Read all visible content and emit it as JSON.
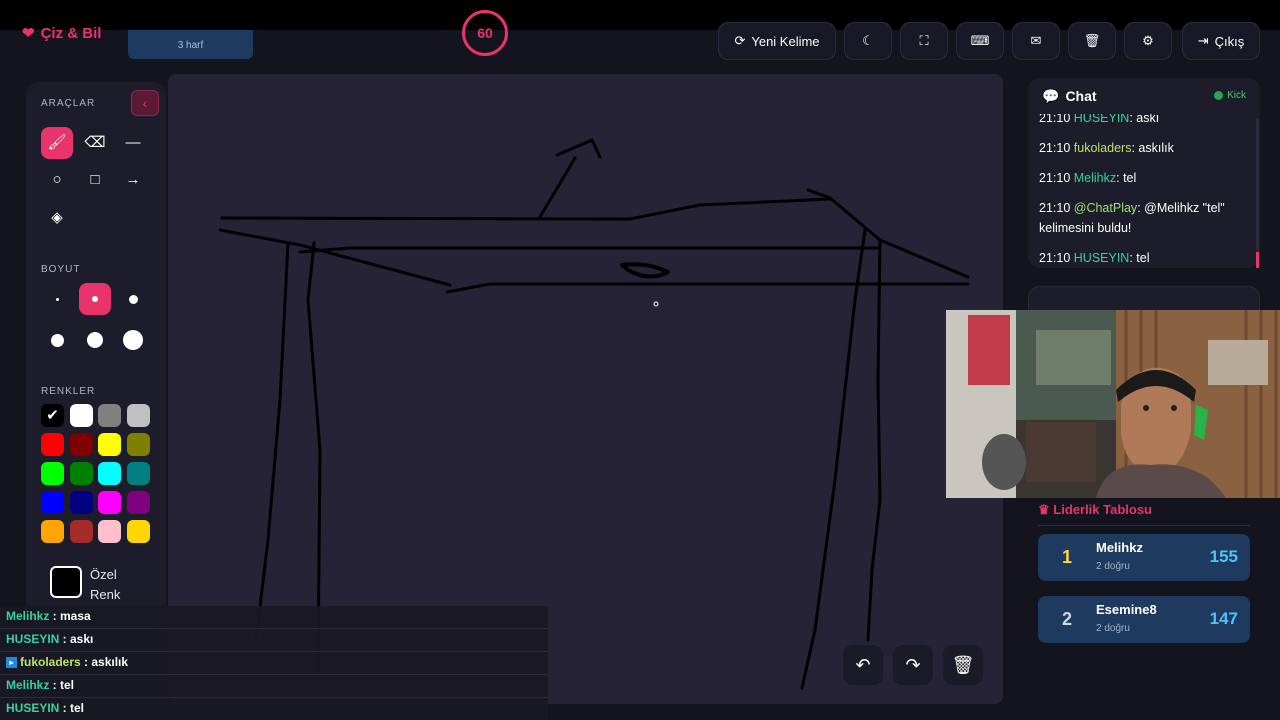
{
  "app": {
    "logo_text": "Çiz & Bil",
    "logo_icon": "heart-icon"
  },
  "word": {
    "hint": "3 harf"
  },
  "timer": {
    "value": "60"
  },
  "toolbar": {
    "new_word_label": "Yeni Kelime",
    "exit_label": "Çıkış",
    "icons": [
      "refresh-icon",
      "moon-icon",
      "fullscreen-icon",
      "keyboard-icon",
      "mail-icon",
      "trash-icon",
      "gear-icon",
      "logout-icon"
    ]
  },
  "tools": {
    "tools_label": "ARAÇLAR",
    "size_label": "BOYUT",
    "colors_label": "RENKLER",
    "custom_color_line1": "Özel",
    "custom_color_line2": "Renk",
    "items": [
      "brush",
      "eraser",
      "line",
      "circle",
      "rectangle",
      "arrow",
      "fill"
    ],
    "active_tool": "brush",
    "sizes": [
      2,
      4,
      5,
      6,
      8,
      10
    ],
    "active_size_index": 1,
    "colors": [
      "#000000",
      "#ffffff",
      "#808080",
      "#c0c0c0",
      "#ff0000",
      "#800000",
      "#ffff00",
      "#808000",
      "#00ff00",
      "#008000",
      "#00ffff",
      "#008080",
      "#0000ff",
      "#000080",
      "#ff00ff",
      "#800080",
      "#ffa500",
      "#a52a2a",
      "#ffc0cb",
      "#ffd700"
    ],
    "selected_color": "#000000"
  },
  "canvas_controls": {
    "undo_icon": "undo-icon",
    "redo_icon": "redo-icon",
    "clear_icon": "trash-icon"
  },
  "chat": {
    "title": "Chat",
    "status": "Kick",
    "messages": [
      {
        "time": "21:10",
        "user": "HUSEYIN",
        "text": ": askı"
      },
      {
        "time": "21:10",
        "user": "fukoladers",
        "text": ": askılık"
      },
      {
        "time": "21:10",
        "user": "Melihkz",
        "text": ": tel"
      },
      {
        "time": "21:10",
        "user": "@ChatPlay",
        "text": ": @Melihkz \"tel\" kelimesini buldu!"
      },
      {
        "time": "21:10",
        "user": "HUSEYIN",
        "text": ": tel"
      }
    ]
  },
  "leaderboard": {
    "title": "Liderlik Tablosu",
    "rows": [
      {
        "rank": "1",
        "name": "Melihkz",
        "sub": "2 doğru",
        "score": "155"
      },
      {
        "rank": "2",
        "name": "Esemine8",
        "sub": "2 doğru",
        "score": "147"
      }
    ]
  },
  "stream_chat": [
    {
      "user": "Melihkz",
      "text": " : masa"
    },
    {
      "user": "HUSEYIN",
      "text": " : askı"
    },
    {
      "user": "fukoladers",
      "text": " : askılık"
    },
    {
      "user": "Melihkz",
      "text": " : tel"
    },
    {
      "user": "HUSEYIN",
      "text": " : tel"
    }
  ]
}
